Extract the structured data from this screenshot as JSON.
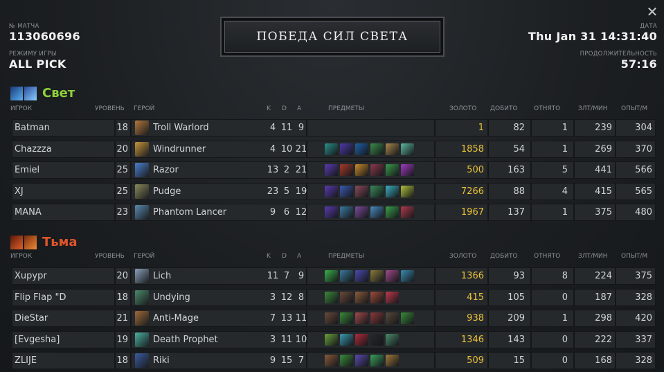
{
  "header": {
    "match_label": "№ МАТЧА",
    "match_id": "113060696",
    "mode_label": "РЕЖИМУ ИГРЫ",
    "mode": "ALL PICK",
    "date_label": "ДАТА",
    "date": "Thu Jan 31 14:31:40",
    "duration_label": "ПРОДОЛЖИТЕЛЬНОСТЬ",
    "duration": "57:16",
    "victory_text": "ПОБЕДА СИЛ СВЕТА"
  },
  "columns": {
    "player": "ИГРОК",
    "level": "УРОВЕНЬ",
    "hero": "ГЕРОЙ",
    "k": "K",
    "d": "D",
    "a": "A",
    "items": "ПРЕДМЕТЫ",
    "gold": "ЗОЛОТО",
    "lh": "ДОБИТО",
    "dn": "ОТНЯТО",
    "gpm": "ЗЛТ/МИН",
    "xpm": "ОПЫТ/М"
  },
  "radiant": {
    "name": "Свет",
    "color": "#8fd13a",
    "players": [
      {
        "player": "Batman",
        "level": "18",
        "hero": "Troll Warlord",
        "k": "4",
        "d": "11",
        "a": "9",
        "gold": "1",
        "lh": "82",
        "dn": "1",
        "gpm": "239",
        "xpm": "304",
        "hero_color": "#b5773d",
        "items": []
      },
      {
        "player": "Chazzza",
        "level": "20",
        "hero": "Windrunner",
        "k": "4",
        "d": "10",
        "a": "21",
        "gold": "1858",
        "lh": "54",
        "dn": "1",
        "gpm": "269",
        "xpm": "370",
        "hero_color": "#c8943a",
        "items": [
          "#2a8f8a",
          "#4b3aa8",
          "#1f5fa8",
          "#3a8a4a",
          "#a8884a",
          "#5fb8a0"
        ]
      },
      {
        "player": "Emiel",
        "level": "25",
        "hero": "Razor",
        "k": "13",
        "d": "2",
        "a": "21",
        "gold": "500",
        "lh": "163",
        "dn": "5",
        "gpm": "441",
        "xpm": "566",
        "hero_color": "#4a7fd0",
        "items": [
          "#5a3ab0",
          "#a83a2a",
          "#c88a2a",
          "#8a3a4a",
          "#3a9a4a",
          "#a03ac0"
        ]
      },
      {
        "player": "XJ",
        "level": "25",
        "hero": "Pudge",
        "k": "23",
        "d": "5",
        "a": "19",
        "gold": "7266",
        "lh": "88",
        "dn": "4",
        "gpm": "415",
        "xpm": "565",
        "hero_color": "#8a8a5a",
        "items": [
          "#5a3ab0",
          "#3a5ab0",
          "#8a4a5a",
          "#3a8a5a",
          "#3ab0c0",
          "#b0c03a"
        ]
      },
      {
        "player": "MANA",
        "level": "23",
        "hero": "Phantom Lancer",
        "k": "9",
        "d": "6",
        "a": "12",
        "gold": "1967",
        "lh": "137",
        "dn": "1",
        "gpm": "375",
        "xpm": "480",
        "hero_color": "#5a8ab0",
        "items": [
          "#5a3ab0",
          "#3a7aa0",
          "#7a4a9a",
          "#4a8ac0",
          "#3aa04a",
          "#b03a4a"
        ]
      }
    ]
  },
  "dire": {
    "name": "Тьма",
    "color": "#e0552a",
    "players": [
      {
        "player": "Xupypr",
        "level": "20",
        "hero": "Lich",
        "k": "11",
        "d": "7",
        "a": "9",
        "gold": "1366",
        "lh": "93",
        "dn": "8",
        "gpm": "224",
        "xpm": "375",
        "hero_color": "#8aa0b8",
        "items": [
          "#3ab04a",
          "#3a7a9a",
          "#4a4ab0",
          "#8a7a3a",
          "#a04a8a",
          "#3a8ab0"
        ]
      },
      {
        "player": "Flip Flap \"D",
        "level": "18",
        "hero": "Undying",
        "k": "3",
        "d": "12",
        "a": "8",
        "gold": "415",
        "lh": "105",
        "dn": "0",
        "gpm": "187",
        "xpm": "328",
        "hero_color": "#4a8a6a",
        "items": [
          "#3a8a3a",
          "#6a4a3a",
          "#8a5a3a",
          "#a04a3a",
          "#c03a4a"
        ]
      },
      {
        "player": "DieStar",
        "level": "21",
        "hero": "Anti-Mage",
        "k": "7",
        "d": "13",
        "a": "11",
        "gold": "938",
        "lh": "209",
        "dn": "1",
        "gpm": "298",
        "xpm": "420",
        "hero_color": "#a06a3a",
        "items": [
          "#6a4a3a",
          "#3a8a3a",
          "#a04a4a",
          "#8a3a3a",
          "#5a4a3a",
          "#3a8a3a"
        ]
      },
      {
        "player": "[Evgesha]",
        "level": "19",
        "hero": "Death Prophet",
        "k": "3",
        "d": "11",
        "a": "10",
        "gold": "1346",
        "lh": "143",
        "dn": "0",
        "gpm": "222",
        "xpm": "337",
        "hero_color": "#4ab0a0",
        "items": [
          "#6aa03a",
          "#3a9ab0",
          "#b02a3a",
          "#26292c",
          "#4a8a6a"
        ]
      },
      {
        "player": "ZLIJE",
        "level": "18",
        "hero": "Riki",
        "k": "9",
        "d": "15",
        "a": "7",
        "gold": "509",
        "lh": "15",
        "dn": "0",
        "gpm": "168",
        "xpm": "328",
        "hero_color": "#3a5aa0",
        "items": [
          "#8a5a3a",
          "#3a8a3a",
          "#5a4ab0",
          "#3aa05a",
          "#a07a3a"
        ]
      }
    ]
  }
}
